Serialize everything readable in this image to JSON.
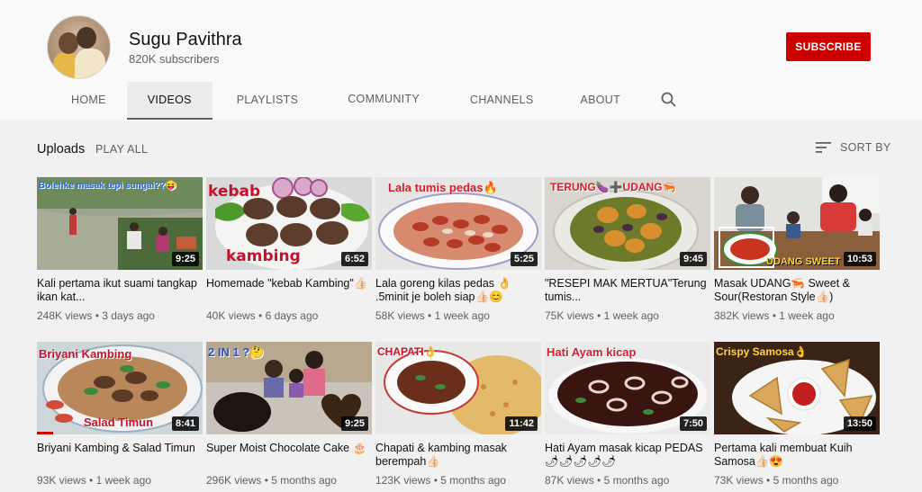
{
  "channel": {
    "name": "Sugu Pavithra",
    "subscribers": "820K subscribers",
    "subscribe_label": "SUBSCRIBE"
  },
  "tabs": [
    {
      "label": "HOME"
    },
    {
      "label": "VIDEOS",
      "active": true
    },
    {
      "label": "PLAYLISTS"
    },
    {
      "label": "COMMUNITY"
    },
    {
      "label": "CHANNELS"
    },
    {
      "label": "ABOUT"
    }
  ],
  "uploads": {
    "title": "Uploads",
    "play_all": "PLAY ALL",
    "sort_by": "SORT BY"
  },
  "videos": [
    {
      "title": "Kali pertama ikut suami tangkap ikan kat...",
      "views": "248K views",
      "age": "3 days ago",
      "duration": "9:25",
      "overlay": "Bolehke masak tepi sungai??😝"
    },
    {
      "title": "Homemade \"kebab Kambing\"👍🏻",
      "views": "40K views",
      "age": "6 days ago",
      "duration": "6:52",
      "overlay": "kebab",
      "overlay2": "kambing"
    },
    {
      "title": "Lala goreng kilas pedas 👌 .5minit je boleh siap👍🏻😊",
      "views": "58K views",
      "age": "1 week ago",
      "duration": "5:25",
      "overlay": "Lala tumis pedas🔥"
    },
    {
      "title": "\"RESEPI MAK MERTUA\"Terung tumis...",
      "views": "75K views",
      "age": "1 week ago",
      "duration": "9:45",
      "overlay": "TERUNG🍆➕UDANG🦐"
    },
    {
      "title": "Masak UDANG🦐 Sweet & Sour(Restoran Style👍🏻)",
      "views": "382K views",
      "age": "1 week ago",
      "duration": "10:53",
      "overlay": "UDANG SWEET"
    },
    {
      "title": "Briyani Kambing & Salad Timun",
      "views": "93K views",
      "age": "1 week ago",
      "duration": "8:41",
      "overlay": "Briyani Kambing",
      "overlay2": "Salad Timun"
    },
    {
      "title": "Super Moist Chocolate Cake 🎂",
      "views": "296K views",
      "age": "5 months ago",
      "duration": "9:25",
      "overlay": "2 IN 1 ?🤔"
    },
    {
      "title": "Chapati & kambing masak berempah👍🏻",
      "views": "123K views",
      "age": "5 months ago",
      "duration": "11:42",
      "overlay": "CHAPATI👌"
    },
    {
      "title": "Hati Ayam masak kicap PEDAS🌶🌶🌶🌶🌶",
      "views": "87K views",
      "age": "5 months ago",
      "duration": "7:50",
      "overlay": "Hati Ayam kicap"
    },
    {
      "title": "Pertama kali membuat Kuih Samosa👍🏻😍",
      "views": "73K views",
      "age": "5 months ago",
      "duration": "13:50",
      "overlay": "Crispy Samosa👌"
    }
  ]
}
